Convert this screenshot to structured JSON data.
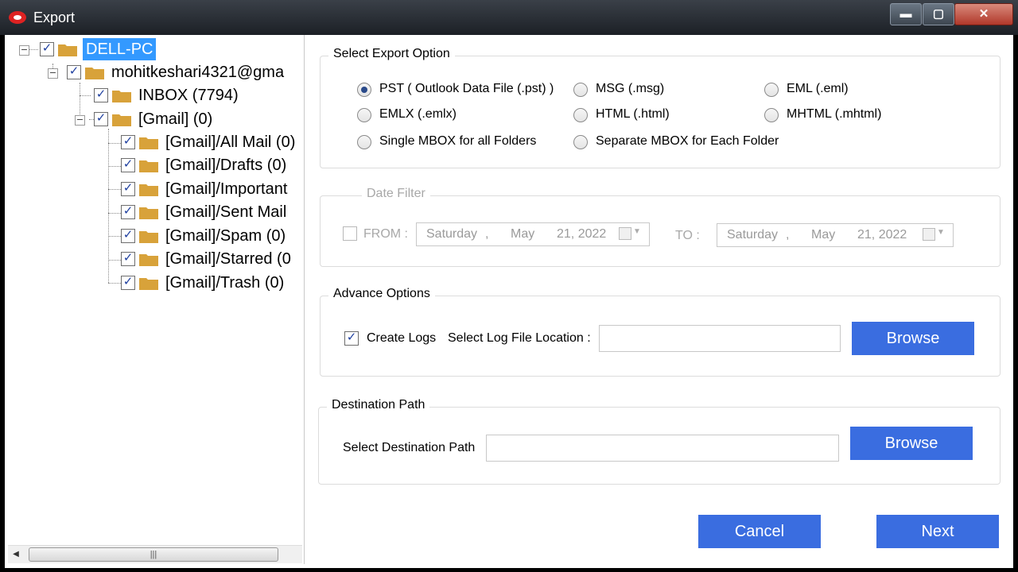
{
  "window": {
    "title": "Export"
  },
  "tree": {
    "root": "DELL-PC",
    "account": "mohitkeshari4321@gma",
    "inbox": "INBOX (7794)",
    "gmail": "[Gmail] (0)",
    "subfolders": [
      "[Gmail]/All Mail (0)",
      "[Gmail]/Drafts (0)",
      "[Gmail]/Important",
      "[Gmail]/Sent Mail",
      "[Gmail]/Spam (0)",
      "[Gmail]/Starred (0",
      "[Gmail]/Trash (0)"
    ]
  },
  "export_option": {
    "legend": "Select Export Option",
    "options": [
      "PST ( Outlook Data File (.pst) )",
      "MSG  (.msg)",
      "EML  (.eml)",
      "EMLX  (.emlx)",
      "HTML  (.html)",
      "MHTML (.mhtml)",
      "Single MBOX for all Folders",
      "Separate MBOX for Each Folder"
    ],
    "selected_index": 0
  },
  "date_filter": {
    "legend": "Date Filter",
    "from_label": "FROM :",
    "to_label": "TO :",
    "from_date": {
      "day": "Saturday",
      "sep": ",",
      "month": "May",
      "date": "21, 2022"
    },
    "to_date": {
      "day": "Saturday",
      "sep": ",",
      "month": "May",
      "date": "21, 2022"
    }
  },
  "advance_options": {
    "legend": "Advance Options",
    "create_logs_label": "Create Logs",
    "log_location_label": "Select Log File Location :",
    "browse_label": "Browse"
  },
  "destination": {
    "legend": "Destination Path",
    "path_label": "Select Destination Path",
    "browse_label": "Browse"
  },
  "footer": {
    "cancel_label": "Cancel",
    "next_label": "Next"
  },
  "colors": {
    "accent_button": "#3a6de0",
    "selection": "#3399ff",
    "folder": "#d8a23a"
  }
}
